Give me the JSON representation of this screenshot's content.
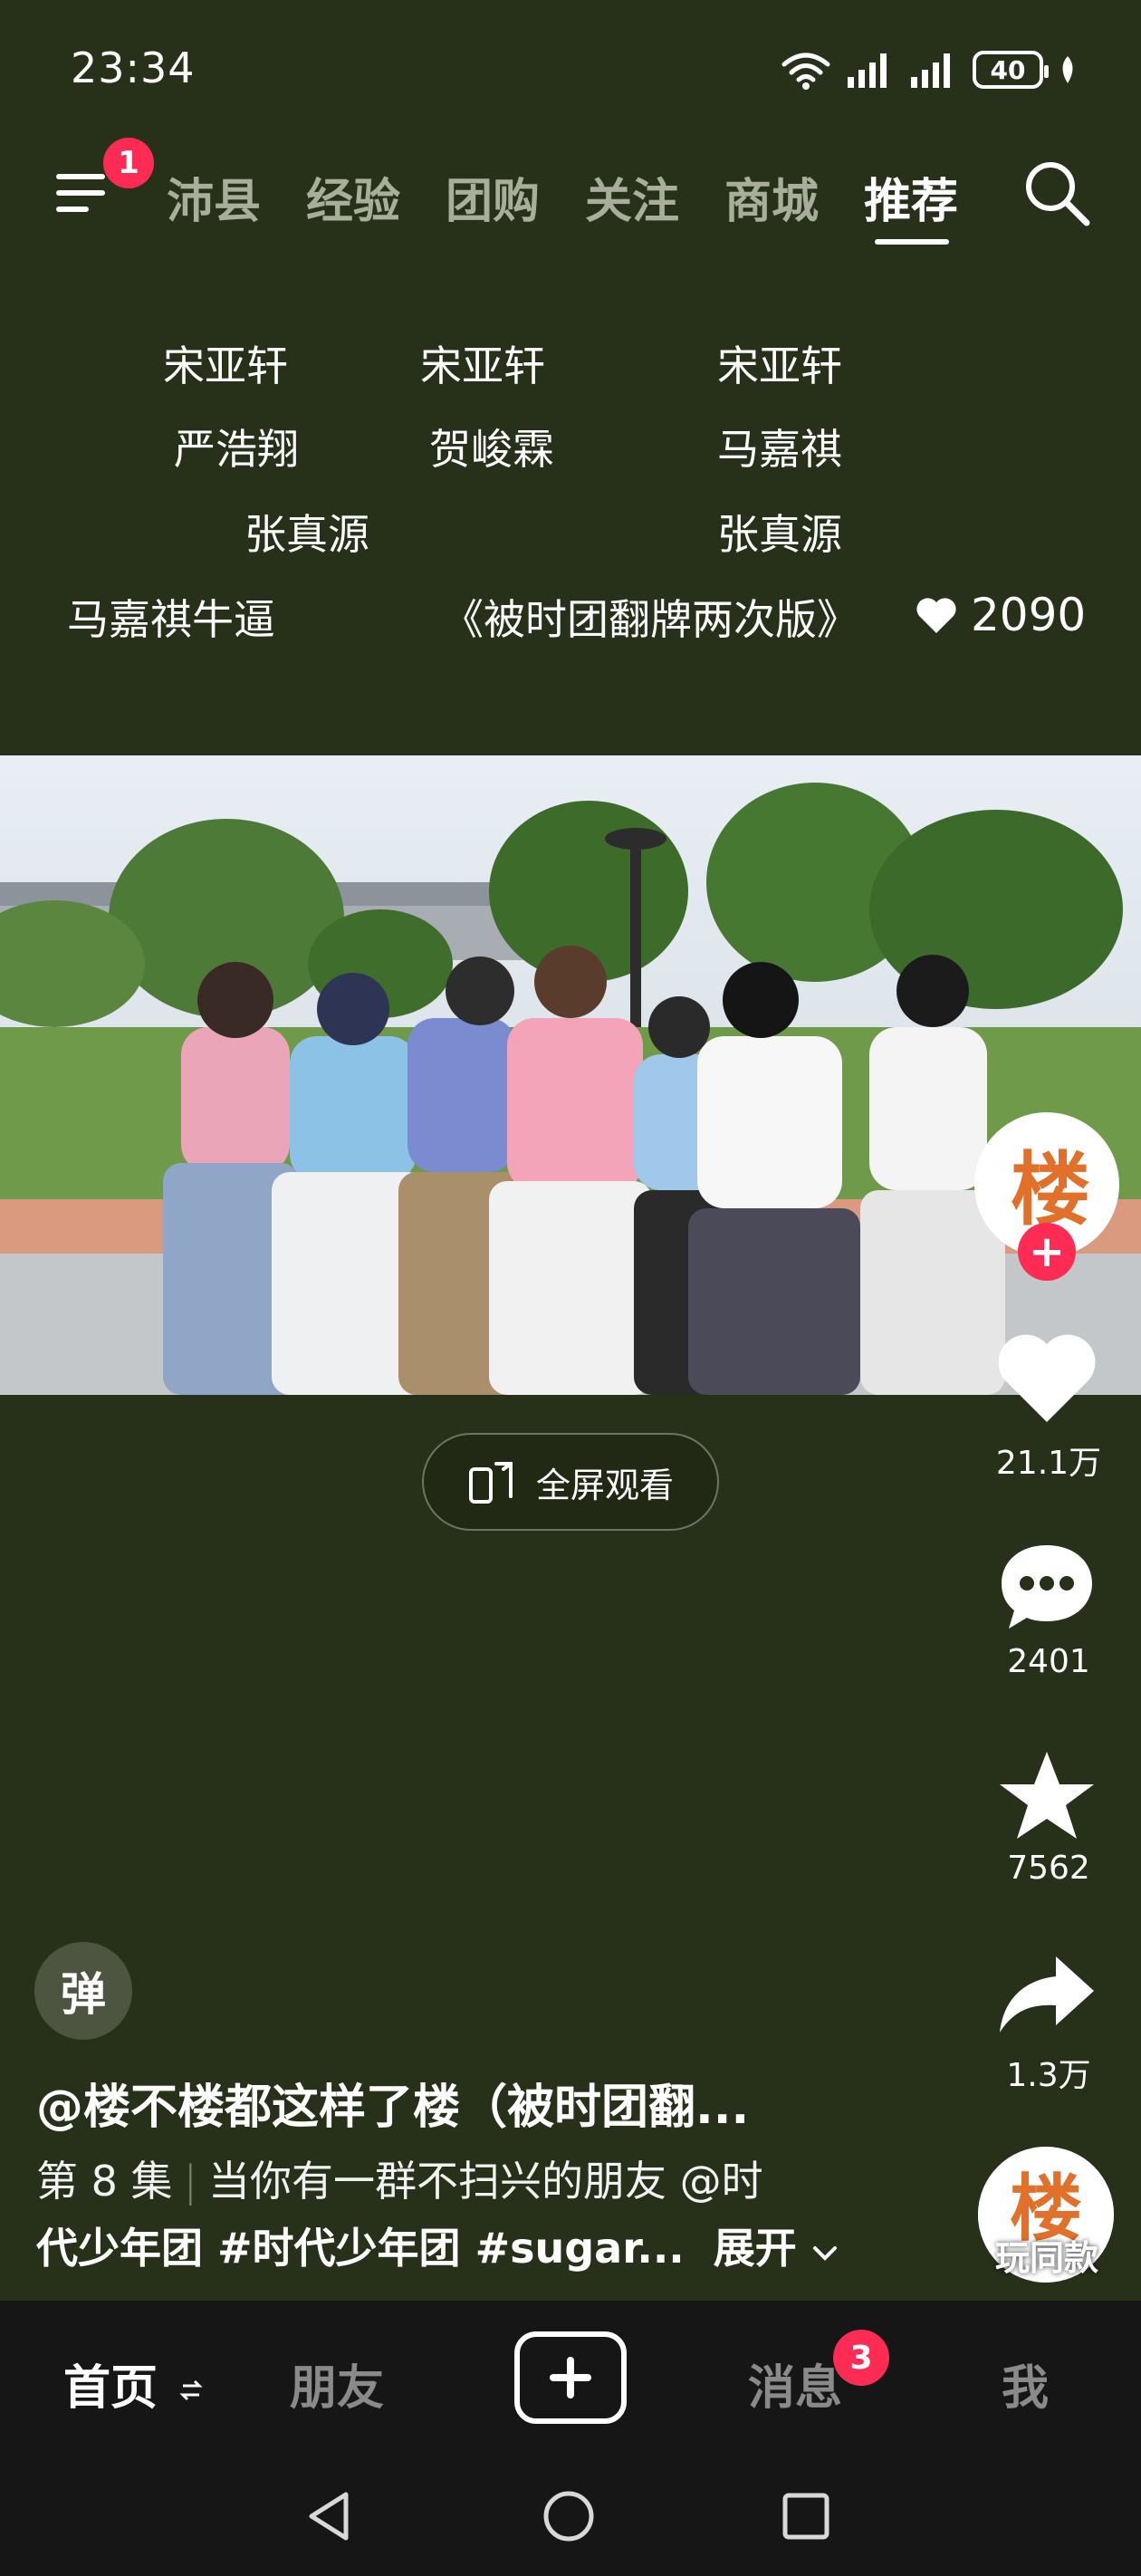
{
  "status_bar": {
    "time": "23:34",
    "battery": "40"
  },
  "top_nav": {
    "menu_badge": "1",
    "tabs": [
      {
        "label": "沛县"
      },
      {
        "label": "经验"
      },
      {
        "label": "团购"
      },
      {
        "label": "关注"
      },
      {
        "label": "商城"
      },
      {
        "label": "推荐"
      }
    ],
    "active_tab": "推荐"
  },
  "overlay_text": {
    "lines": [
      [
        "宋亚轩",
        "宋亚轩",
        "宋亚轩"
      ],
      [
        "严浩翔",
        "贺峻霖",
        "马嘉祺"
      ],
      [
        "张真源",
        "张真源"
      ]
    ],
    "footer_left": "马嘉祺牛逼",
    "footer_title": "《被时团翻牌两次版》",
    "footer_likes": "2090"
  },
  "video": {
    "fullscreen_label": "全屏观看"
  },
  "right_rail": {
    "avatar_text": "楼",
    "likes": "21.1万",
    "comments": "2401",
    "favorites": "7562",
    "shares": "1.3万",
    "remix_label": "玩同款"
  },
  "caption": {
    "danmaku": "弹",
    "author": "@楼不楼都这样了楼（被时团翻...",
    "episode": "第 8 集",
    "line1": "当你有一群不扫兴的朋友 @时",
    "line2": "代少年团 #时代少年团 #sugar...",
    "expand": "展开"
  },
  "bottom_tabs": {
    "home": "首页",
    "friends": "朋友",
    "messages": "消息",
    "messages_badge": "3",
    "me": "我"
  },
  "colors": {
    "background": "#273018",
    "accent": "#fe2c55",
    "tabbar": "#161616"
  }
}
